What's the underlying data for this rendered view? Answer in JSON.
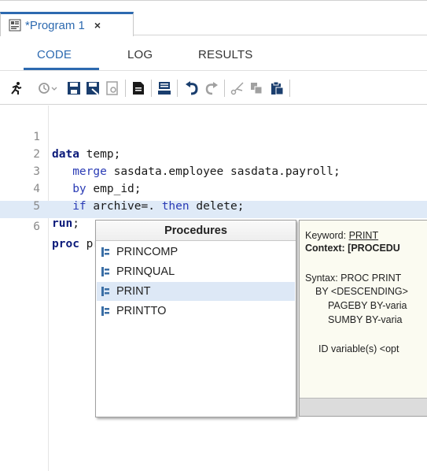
{
  "tab": {
    "title": "*Program 1",
    "close": "×",
    "icon": "sas-program-icon"
  },
  "subtabs": [
    {
      "label": "CODE",
      "active": true
    },
    {
      "label": "LOG",
      "active": false
    },
    {
      "label": "RESULTS",
      "active": false
    }
  ],
  "toolbar": [
    "run-icon",
    "history-icon",
    "save-icon",
    "save-as-icon",
    "open-icon",
    "submit-selected-icon",
    "format-icon",
    "undo-icon",
    "redo-icon",
    "cut-icon",
    "copy-icon",
    "paste-icon"
  ],
  "editor": {
    "lines": [
      {
        "n": "1",
        "kw": "data",
        "rest": " temp;"
      },
      {
        "n": "2",
        "indent": "   ",
        "kw": "merge",
        "rest": " sasdata.employee sasdata.payroll;"
      },
      {
        "n": "3",
        "indent": "   ",
        "kw": "by",
        "rest": " emp_id;"
      },
      {
        "n": "4",
        "indent": "   ",
        "kw": "if",
        "rest": " archive=. ",
        "kw2": "then",
        "rest2": " delete;"
      },
      {
        "n": "5",
        "kw": "run",
        "rest": ";"
      },
      {
        "n": "6",
        "kw": "proc",
        "rest": " prin",
        "current": true
      }
    ]
  },
  "autocomplete": {
    "header": "Procedures",
    "items": [
      "PRINCOMP",
      "PRINQUAL",
      "PRINT",
      "PRINTTO"
    ],
    "selected": "PRINT"
  },
  "help": {
    "keyword_label": "Keyword:",
    "keyword": "PRINT",
    "context": "Context: [PROCEDU",
    "syntax": "Syntax: PROC PRINT",
    "by": "BY <DESCENDING>",
    "pageby": "PAGEBY BY-varia",
    "sumby": "SUMBY BY-varia",
    "id": "ID variable(s) <opt"
  },
  "colors": {
    "accent": "#2d6ab0",
    "data_step_keyword": "#0b1a7a",
    "keyword": "#2a3bb5",
    "selection": "#dde8f6",
    "current_line": "#dfeaf7"
  }
}
